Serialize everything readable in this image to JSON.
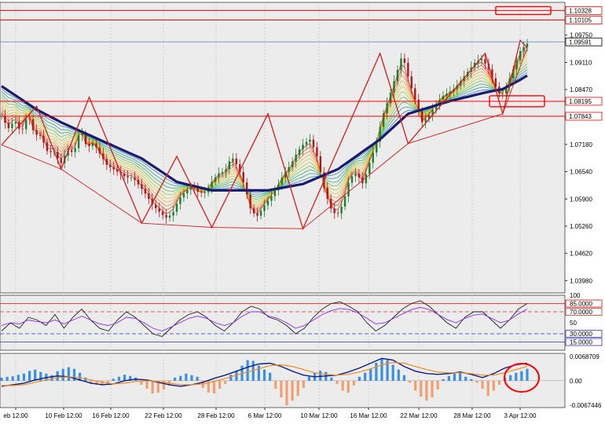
{
  "window": {
    "title": "EURUSD H4"
  },
  "colors": {
    "background": "#ffffff",
    "plot_bg": "#ececec",
    "grid": "#c8c8c8",
    "bull": "#1a7f2e",
    "bear": "#b01818",
    "ma_slow": "#1a1a6e",
    "zigzag": "#d21e1e",
    "level": "#ff0000",
    "bid_line": "#6f8ec7",
    "hist_pos": "#3a8fe0",
    "hist_neg": "#f0a070",
    "macd_line": "#0a1e8c",
    "signal_line": "#f08c1e",
    "rsi_line": "#202020",
    "rsi_ma": "#8a2be2",
    "osc_dash_upper": "#c83232",
    "osc_dash_lower": "#3232c8"
  },
  "chart_data": [
    {
      "type": "candlestick",
      "panel": "price",
      "y_axis_ticks": [
        "1.10770",
        "1.09750",
        "1.09110",
        "1.08470",
        "1.07180",
        "1.06540",
        "1.05900",
        "1.05260",
        "1.04620",
        "1.03980"
      ],
      "ylim": [
        1.0369,
        1.1052
      ],
      "x_axis_ticks": [
        "eb 12:00",
        "10 Feb 12:00",
        "16 Feb 12:00",
        "22 Feb 12:00",
        "28 Feb 12:00",
        "6 Mar 12:00",
        "10 Mar 12:00",
        "16 Mar 12:00",
        "22 Mar 12:00",
        "28 Mar 12:00",
        "3 Apr 12:00"
      ],
      "current_price": {
        "label": "1.09591",
        "value": 1.09591
      },
      "levels": [
        {
          "label": "1.10328",
          "value": 1.10328
        },
        {
          "label": "1.10105",
          "value": 1.10105
        },
        {
          "label": "1.08195",
          "value": 1.08195
        },
        {
          "label": "1.07843",
          "value": 1.07843
        }
      ],
      "close_path": [
        1.0785,
        1.0755,
        1.0775,
        1.0745,
        1.079,
        1.0742,
        1.0738,
        1.07,
        1.07,
        1.0672,
        1.0705,
        1.0698,
        1.0755,
        1.071,
        1.0722,
        1.0695,
        1.067,
        1.066,
        1.065,
        1.064,
        1.064,
        1.062,
        1.06,
        1.0575,
        1.056,
        1.0545,
        1.0555,
        1.059,
        1.0608,
        1.062,
        1.0605,
        1.0605,
        1.063,
        1.065,
        1.0655,
        1.069,
        1.0665,
        1.062,
        1.056,
        1.055,
        1.0575,
        1.0595,
        1.062,
        1.065,
        1.067,
        1.07,
        1.072,
        1.073,
        1.069,
        1.062,
        1.057,
        1.055,
        1.058,
        1.064,
        1.065,
        1.0625,
        1.0675,
        1.072,
        1.0785,
        1.083,
        1.088,
        1.093,
        1.087,
        1.082,
        1.077,
        1.0785,
        1.081,
        1.083,
        1.084,
        1.085,
        1.087,
        1.089,
        1.091,
        1.092,
        1.09,
        1.086,
        1.083,
        1.086,
        1.09,
        1.094,
        1.0955
      ],
      "zigzag": [
        [
          0,
          1.0717
        ],
        [
          10,
          1.0808
        ],
        [
          17,
          1.066
        ],
        [
          25,
          1.0829
        ],
        [
          40,
          1.0533
        ],
        [
          50,
          1.069
        ],
        [
          60,
          1.0523
        ],
        [
          76,
          1.079
        ],
        [
          86,
          1.052
        ],
        [
          108,
          1.0932
        ],
        [
          116,
          1.072
        ],
        [
          138,
          1.0932
        ],
        [
          143,
          1.079
        ],
        [
          148,
          1.0963
        ],
        [
          150,
          1.0945
        ]
      ],
      "slow_ma": [
        [
          0,
          1.0855
        ],
        [
          10,
          1.08
        ],
        [
          17,
          1.077
        ],
        [
          25,
          1.074
        ],
        [
          40,
          1.0685
        ],
        [
          50,
          1.063
        ],
        [
          60,
          1.061
        ],
        [
          76,
          1.061
        ],
        [
          86,
          1.0625
        ],
        [
          96,
          1.066
        ],
        [
          108,
          1.073
        ],
        [
          116,
          1.079
        ],
        [
          128,
          1.082
        ],
        [
          138,
          1.084
        ],
        [
          143,
          1.0848
        ],
        [
          148,
          1.087
        ],
        [
          150,
          1.088
        ]
      ],
      "bar_count": 151
    },
    {
      "type": "line",
      "panel": "rsi",
      "y_axis_ticks": [
        "100",
        "85.0000",
        "70.0000",
        "50",
        "30.0000",
        "15.0000"
      ],
      "levels": [
        85,
        70,
        30,
        15
      ],
      "ylim": [
        0,
        100
      ],
      "series": [
        {
          "values": [
            35,
            50,
            40,
            60,
            55,
            45,
            65,
            40,
            60,
            75,
            55,
            40,
            35,
            55,
            70,
            60,
            45,
            30,
            25,
            40,
            55,
            65,
            70,
            60,
            45,
            35,
            50,
            70,
            80,
            75,
            60,
            55,
            45,
            30,
            40,
            60,
            75,
            85,
            88,
            80,
            70,
            50,
            35,
            45,
            60,
            75,
            85,
            90,
            80,
            65,
            50,
            40,
            60,
            70,
            70,
            55,
            40,
            55,
            75,
            85
          ]
        },
        {
          "values": [
            45,
            50,
            48,
            55,
            52,
            50,
            55,
            48,
            55,
            62,
            55,
            48,
            45,
            50,
            60,
            58,
            50,
            40,
            35,
            42,
            50,
            58,
            62,
            58,
            50,
            45,
            50,
            62,
            70,
            70,
            62,
            58,
            50,
            40,
            45,
            55,
            65,
            72,
            76,
            74,
            68,
            58,
            48,
            50,
            58,
            66,
            74,
            78,
            74,
            65,
            56,
            50,
            58,
            64,
            66,
            58,
            50,
            55,
            66,
            75
          ]
        }
      ]
    },
    {
      "type": "bar",
      "panel": "macd",
      "y_axis_ticks": [
        "0.0068709",
        "0.00",
        "-0.0067446"
      ],
      "ylim": [
        -0.0067446,
        0.0068709
      ],
      "histogram": [
        0.0008,
        0.001,
        0.0011,
        0.0015,
        0.0018,
        0.0025,
        0.0028,
        0.0022,
        0.0018,
        0.0014,
        0.0024,
        0.003,
        0.0034,
        0.003,
        0.002,
        0.0008,
        -0.0008,
        -0.001,
        -0.0012,
        -0.001,
        0.0005,
        0.001,
        0.0015,
        0.0012,
        0.0008,
        -0.001,
        -0.002,
        -0.0032,
        -0.003,
        -0.0022,
        -0.0012,
        0.0008,
        0.0012,
        0.0018,
        0.0014,
        0.001,
        -0.0018,
        -0.003,
        -0.0032,
        -0.002,
        -0.0008,
        0.0015,
        0.0025,
        0.0038,
        0.0052,
        0.005,
        0.0038,
        0.0028,
        0.002,
        -0.002,
        -0.0042,
        -0.0062,
        -0.005,
        -0.0038,
        -0.0018,
        0.001,
        0.002,
        0.0025,
        0.0022,
        0.0008,
        -0.0008,
        -0.0025,
        -0.003,
        -0.0012,
        0.001,
        0.002,
        0.003,
        0.0045,
        0.0054,
        0.0052,
        0.004,
        0.0028,
        0.0014,
        -0.0005,
        -0.0025,
        -0.004,
        -0.005,
        -0.0042,
        -0.0022,
        0.0004,
        0.0012,
        0.0018,
        0.0022,
        0.001,
        0.0004,
        -0.0005,
        -0.002,
        -0.0038,
        -0.0025,
        -0.001,
        0.0008,
        0.0014,
        0.002,
        0.0024,
        0.003
      ],
      "macd_line": [
        -0.0014,
        -0.001,
        -0.0006,
        0.0002,
        0.0008,
        0.0012,
        0.001,
        0.0002,
        -0.0006,
        -0.001,
        -0.0008,
        0.0,
        0.0004,
        0.0002,
        -0.0004,
        -0.001,
        -0.0014,
        -0.001,
        -0.0004,
        0.0006,
        0.0014,
        0.0024,
        0.0034,
        0.0042,
        0.0044,
        0.0036,
        0.0024,
        0.0014,
        0.001,
        0.0012,
        0.0014,
        0.0022,
        0.0032,
        0.0044,
        0.0056,
        0.0052,
        0.0036,
        0.0024,
        0.0018,
        0.0016,
        0.0018,
        0.0022,
        0.0016,
        0.0008,
        0.0018,
        0.0032,
        0.004,
        0.0044
      ],
      "signal_line": [
        -0.0012,
        -0.0012,
        -0.001,
        -0.0004,
        0.0002,
        0.0008,
        0.001,
        0.0008,
        0.0002,
        -0.0004,
        -0.0008,
        -0.0006,
        -0.0002,
        0.0,
        -0.0002,
        -0.0006,
        -0.001,
        -0.001,
        -0.0008,
        -0.0002,
        0.0006,
        0.0014,
        0.0022,
        0.003,
        0.0038,
        0.004,
        0.0036,
        0.0028,
        0.002,
        0.0016,
        0.0014,
        0.0016,
        0.0022,
        0.003,
        0.004,
        0.0046,
        0.0044,
        0.0036,
        0.0028,
        0.0022,
        0.002,
        0.002,
        0.0018,
        0.0014,
        0.0014,
        0.002,
        0.0028,
        0.0036
      ]
    }
  ]
}
